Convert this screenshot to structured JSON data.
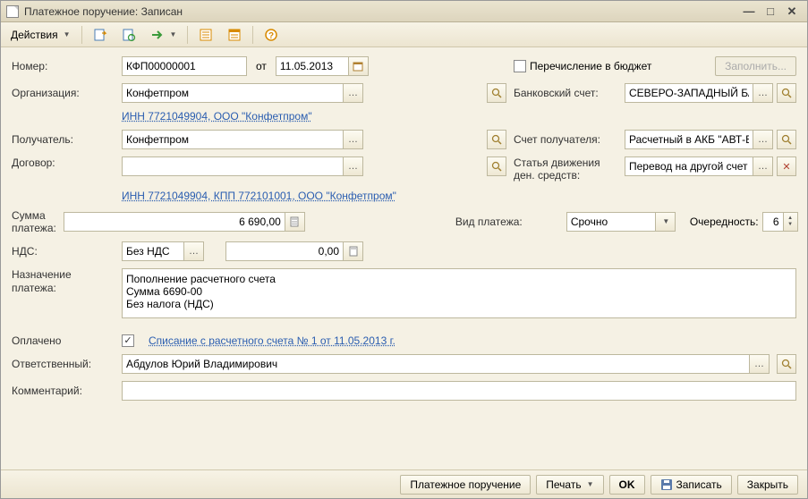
{
  "window": {
    "title": "Платежное поручение: Записан"
  },
  "toolbar": {
    "actions": "Действия"
  },
  "labels": {
    "number": "Номер:",
    "from": "от",
    "budget_transfer": "Перечисление в бюджет",
    "fill": "Заполнить...",
    "organization": "Организация:",
    "bank_account": "Банковский счет:",
    "recipient": "Получатель:",
    "recipient_account": "Счет получателя:",
    "contract": "Договор:",
    "flow_item": "Статья движения ден. средств:",
    "payment_sum": "Сумма платежа:",
    "payment_type": "Вид платежа:",
    "priority": "Очередность:",
    "vat": "НДС:",
    "purpose": "Назначение платежа:",
    "paid": "Оплачено",
    "responsible": "Ответственный:",
    "comment": "Комментарий:"
  },
  "values": {
    "number": "КФП00000001",
    "date": "11.05.2013",
    "organization": "Конфетпром",
    "org_link": "ИНН 7721049904, ООО \"Конфетпром\"",
    "bank_account": "СЕВЕРО-ЗАПАДНЫЙ БАНК ОАО \"СБЕ",
    "recipient": "Конфетпром",
    "recipient_account": "Расчетный в АКБ \"АВТ-БАНК\"",
    "contract": "",
    "recipient_link": "ИНН 7721049904, КПП 772101001, ООО \"Конфетпром\"",
    "flow_item": "Перевод на другой счет",
    "sum": "6 690,00",
    "payment_type": "Срочно",
    "priority": "6",
    "vat_type": "Без НДС",
    "vat_sum": "0,00",
    "purpose": "Пополнение расчетного счета\nСумма 6690-00\nБез налога (НДС)",
    "paid_link": "Списание с расчетного счета № 1 от 11.05.2013 г.",
    "responsible": "Абдулов Юрий Владимирович",
    "comment": ""
  },
  "footer": {
    "doc_name": "Платежное поручение",
    "print": "Печать",
    "ok": "OK",
    "record": "Записать",
    "close": "Закрыть"
  }
}
